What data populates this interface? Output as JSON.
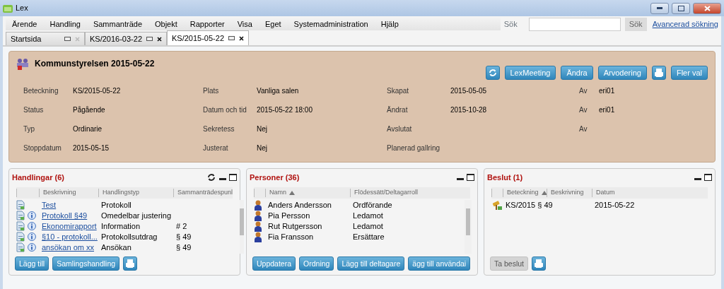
{
  "window": {
    "title": "Lex"
  },
  "menu": [
    "Ärende",
    "Handling",
    "Sammanträde",
    "Objekt",
    "Rapporter",
    "Visa",
    "Eget",
    "Systemadministration",
    "Hjälp"
  ],
  "search": {
    "label": "Sök",
    "button": "Sök",
    "advanced_link": "Avancerad sökning"
  },
  "tabs": [
    {
      "label": "Startsida",
      "selected": false,
      "closable": false
    },
    {
      "label": "KS/2016-03-22",
      "selected": false,
      "closable": true
    },
    {
      "label": "KS/2015-05-22",
      "selected": true,
      "closable": true
    }
  ],
  "meeting": {
    "title": "Kommunstyrelsen 2015-05-22",
    "actions": [
      {
        "kind": "refresh"
      },
      {
        "kind": "text",
        "label": "LexMeeting"
      },
      {
        "kind": "text",
        "label": "Ändra"
      },
      {
        "kind": "text",
        "label": "Arvodering"
      },
      {
        "kind": "print"
      },
      {
        "kind": "text",
        "label": "Fler val"
      }
    ],
    "fields": [
      [
        {
          "label": "Beteckning",
          "value": "KS/2015-05-22"
        },
        {
          "label": "Plats",
          "value": "Vanliga salen"
        },
        {
          "label": "Skapat",
          "value": "2015-05-05"
        },
        {
          "label": "Av",
          "value": "eri01"
        }
      ],
      [
        {
          "label": "Status",
          "value": "Pågående"
        },
        {
          "label": "Datum och tid",
          "value": "2015-05-22 18:00"
        },
        {
          "label": "Ändrat",
          "value": "2015-10-28"
        },
        {
          "label": "Av",
          "value": "eri01"
        }
      ],
      [
        {
          "label": "Typ",
          "value": "Ordinarie"
        },
        {
          "label": "Sekretess",
          "value": "Nej"
        },
        {
          "label": "Avslutat"
        },
        {
          "label": "Av"
        }
      ],
      [
        {
          "label": "Stoppdatum",
          "value": "2015-05-15"
        },
        {
          "label": "Justerat",
          "value": "Nej"
        },
        {
          "label": "Planerad gallring"
        }
      ]
    ]
  },
  "panels": [
    {
      "kind": "documents",
      "title": "Handlingar (6)",
      "refreshable": true,
      "columns": [
        {
          "label": "Beskrivning",
          "sorted_ascending": false
        },
        {
          "label": "Handlingstyp",
          "sorted_ascending": false
        },
        {
          "label": "Sammanträdespunl",
          "sorted_ascending": false
        }
      ],
      "rows": [
        {
          "info": false,
          "cells": [
            "Test",
            "Protokoll",
            ""
          ]
        },
        {
          "info": true,
          "cells": [
            "Protokoll §49",
            "Omedelbar justering",
            ""
          ]
        },
        {
          "info": true,
          "cells": [
            "Ekonomirapport",
            "Information",
            "# 2"
          ]
        },
        {
          "info": true,
          "cells": [
            "§10 - protokoll...",
            "Protokollsutdrag",
            "§ 49"
          ]
        },
        {
          "info": true,
          "cells": [
            "ansökan om xx",
            "Ansökan",
            "§ 49"
          ]
        }
      ],
      "buttons": [
        {
          "kind": "text",
          "label": "Lägg till",
          "disabled": false
        },
        {
          "kind": "text",
          "label": "Samlingshandling",
          "disabled": false
        },
        {
          "kind": "print"
        }
      ]
    },
    {
      "kind": "persons",
      "title": "Personer (36)",
      "refreshable": false,
      "columns": [
        {
          "label": "Namn",
          "sorted_ascending": true
        },
        {
          "label": "Flödessätt/Deltagarroll",
          "sorted_ascending": false
        }
      ],
      "rows": [
        {
          "cells": [
            "Anders Andersson",
            "Ordförande"
          ]
        },
        {
          "cells": [
            "Pia Persson",
            "Ledamot"
          ]
        },
        {
          "cells": [
            "Rut Rutgersson",
            "Ledamot"
          ]
        },
        {
          "cells": [
            "Fia Fransson",
            "Ersättare"
          ]
        }
      ],
      "buttons": [
        {
          "kind": "text",
          "label": "Uppdatera",
          "disabled": false
        },
        {
          "kind": "text",
          "label": "Ordning",
          "disabled": false
        },
        {
          "kind": "text",
          "label": "Lägg till deltagare",
          "disabled": false
        },
        {
          "kind": "text",
          "label": "ägg till användai",
          "disabled": false
        }
      ]
    },
    {
      "kind": "decisions",
      "title": "Beslut (1)",
      "refreshable": false,
      "columns": [
        {
          "label": "Beteckning",
          "sorted_ascending": true
        },
        {
          "label": "Beskrivning",
          "sorted_ascending": false
        },
        {
          "label": "Datum",
          "sorted_ascending": false
        }
      ],
      "rows": [
        {
          "cells": [
            "KS/2015 § 49",
            "",
            "2015-05-22"
          ]
        }
      ],
      "buttons": [
        {
          "kind": "text",
          "label": "Ta beslut",
          "disabled": true
        },
        {
          "kind": "print"
        }
      ]
    }
  ]
}
